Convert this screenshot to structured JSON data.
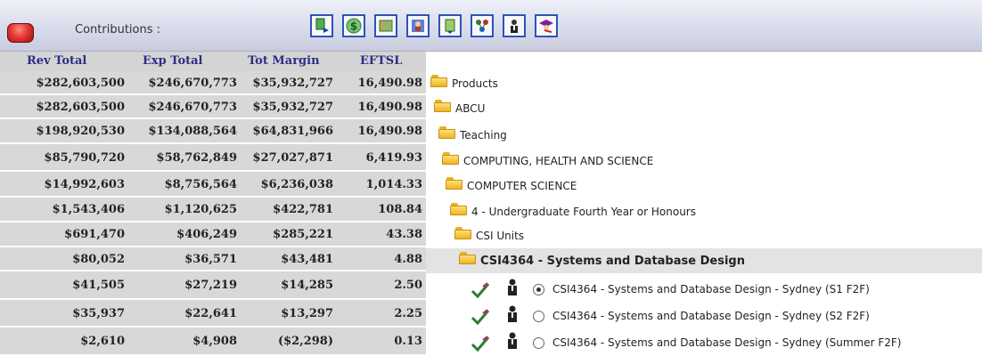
{
  "toolbar": {
    "label": "Contributions :",
    "icons": [
      "export-icon",
      "dollar-icon",
      "book-icon",
      "person-tile-icon",
      "refresh-icon",
      "network-icon",
      "staff-icon",
      "graduate-icon"
    ],
    "accent": "#2c53b8"
  },
  "table": {
    "columns": [
      "Rev Total",
      "Exp Total",
      "Tot Margin",
      "EFTSL"
    ],
    "rows": [
      [
        "$282,603,500",
        "$246,670,773",
        "$35,932,727",
        "16,490.98"
      ],
      [
        "$282,603,500",
        "$246,670,773",
        "$35,932,727",
        "16,490.98"
      ],
      [
        "$198,920,530",
        "$134,088,564",
        "$64,831,966",
        "16,490.98"
      ],
      [
        "$85,790,720",
        "$58,762,849",
        "$27,027,871",
        "6,419.93"
      ],
      [
        "$14,992,603",
        "$8,756,564",
        "$6,236,038",
        "1,014.33"
      ],
      [
        "$1,543,406",
        "$1,120,625",
        "$422,781",
        "108.84"
      ],
      [
        "$691,470",
        "$406,249",
        "$285,221",
        "43.38"
      ],
      [
        "$80,052",
        "$36,571",
        "$43,481",
        "4.88"
      ],
      [
        "$41,505",
        "$27,219",
        "$14,285",
        "2.50"
      ],
      [
        "$35,937",
        "$22,641",
        "$13,297",
        "2.25"
      ],
      [
        "$2,610",
        "$4,908",
        "($2,298)",
        "0.13"
      ]
    ]
  },
  "tree": {
    "nodes": [
      {
        "label": "Products"
      },
      {
        "label": "ABCU"
      },
      {
        "label": "Teaching"
      },
      {
        "label": "COMPUTING, HEALTH AND SCIENCE"
      },
      {
        "label": "COMPUTER SCIENCE"
      },
      {
        "label": "4 - Undergraduate Fourth Year or Honours"
      },
      {
        "label": "CSI Units"
      },
      {
        "label": "CSI4364 - Systems and Database Design"
      }
    ],
    "offerings": [
      {
        "label": "CSI4364 - Systems and Database Design - Sydney (S1 F2F)",
        "selected": true
      },
      {
        "label": "CSI4364 - Systems and Database Design - Sydney (S2 F2F)",
        "selected": false
      },
      {
        "label": "CSI4364 - Systems and Database Design - Sydney (Summer F2F)",
        "selected": false
      }
    ]
  }
}
